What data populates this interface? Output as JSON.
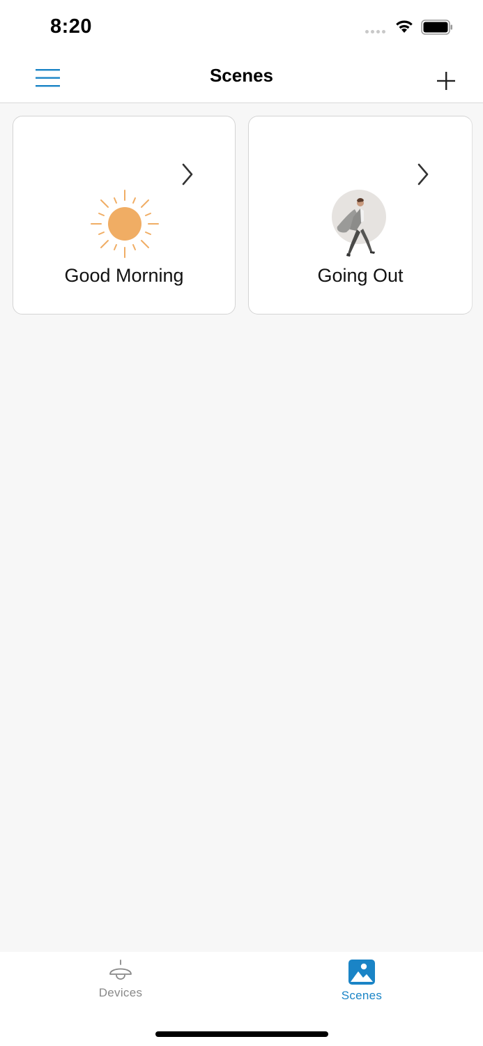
{
  "status_bar": {
    "time": "8:20"
  },
  "header": {
    "title": "Scenes",
    "menu_icon": "hamburger-menu-icon",
    "add_icon": "plus-icon",
    "accent_color": "#1a84c6"
  },
  "scenes": [
    {
      "label": "Good Morning",
      "icon": "sun-icon",
      "accent_color": "#f0ad64"
    },
    {
      "label": "Going Out",
      "icon": "walking-person-icon"
    }
  ],
  "tab_bar": {
    "tabs": [
      {
        "label": "Devices",
        "icon": "ceiling-lamp-icon",
        "selected": false
      },
      {
        "label": "Scenes",
        "icon": "picture-icon",
        "selected": true
      }
    ],
    "selected_color": "#1a84c6",
    "unselected_color": "#888888"
  }
}
